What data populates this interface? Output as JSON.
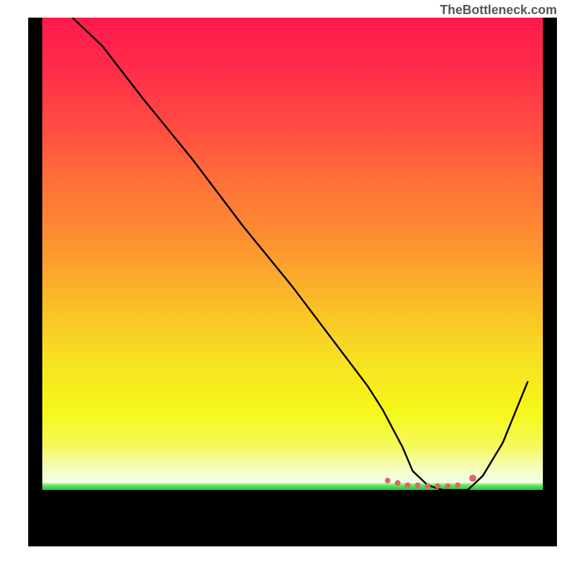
{
  "watermark": "TheBottleneck.com",
  "chart_data": {
    "type": "line",
    "title": "",
    "xlabel": "",
    "ylabel": "",
    "xlim": [
      0,
      100
    ],
    "ylim": [
      0,
      100
    ],
    "series": [
      {
        "name": "bottleneck-curve",
        "x": [
          6,
          8,
          12,
          20,
          30,
          40,
          50,
          60,
          65,
          68,
          70,
          72,
          74,
          77,
          80,
          82,
          85,
          88,
          92,
          97
        ],
        "y": [
          100,
          98,
          94,
          83,
          70,
          56,
          43,
          29,
          22,
          17,
          13,
          9,
          4,
          1,
          0,
          0,
          0,
          3,
          10,
          23
        ]
      }
    ],
    "markers": {
      "name": "highlight-points",
      "color": "#d86868",
      "x": [
        69,
        71,
        73,
        75,
        77,
        79,
        81,
        83,
        86
      ],
      "y": [
        2,
        1.5,
        1,
        1,
        0.8,
        0.8,
        0.8,
        1,
        2.5
      ]
    }
  }
}
